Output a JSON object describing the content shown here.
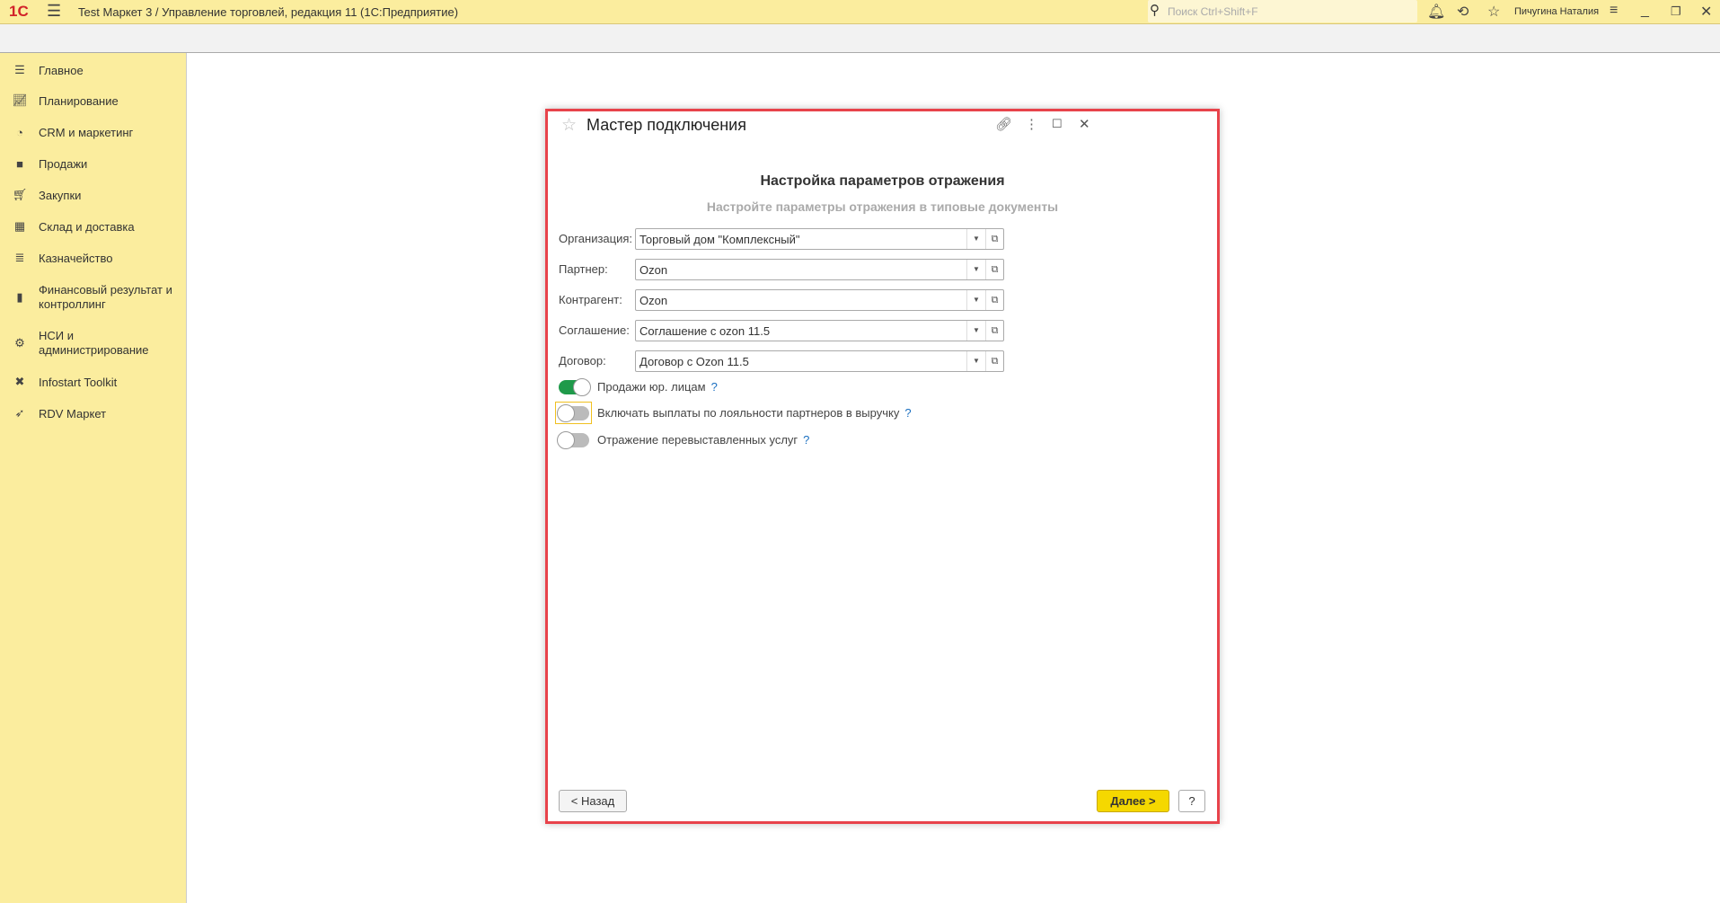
{
  "topbar": {
    "logo": "1С",
    "title": "Test Маркет 3 / Управление торговлей, редакция 11  (1С:Предприятие)",
    "search_placeholder": "Поиск Ctrl+Shift+F",
    "user": "Пичугина Наталия"
  },
  "sidebar": {
    "items": [
      {
        "label": "Главное",
        "icon": "menu-icon"
      },
      {
        "label": "Планирование",
        "icon": "chart-icon"
      },
      {
        "label": "CRM и маркетинг",
        "icon": "pie-icon"
      },
      {
        "label": "Продажи",
        "icon": "bag-icon"
      },
      {
        "label": "Закупки",
        "icon": "cart-icon"
      },
      {
        "label": "Склад и доставка",
        "icon": "grid-icon"
      },
      {
        "label": "Казначейство",
        "icon": "coins-icon"
      },
      {
        "label": "Финансовый результат и контроллинг",
        "icon": "bar-chart-icon"
      },
      {
        "label": "НСИ и администрирование",
        "icon": "gear-icon"
      },
      {
        "label": "Infostart Toolkit",
        "icon": "tools-icon"
      },
      {
        "label": "RDV Маркет",
        "icon": "rocket-icon"
      }
    ]
  },
  "dialog": {
    "title": "Мастер подключения",
    "heading": "Настройка параметров отражения",
    "subheading": "Настройте параметры отражения в типовые документы",
    "fields": [
      {
        "label": "Организация:",
        "value": "Торговый дом \"Комплексный\""
      },
      {
        "label": "Партнер:",
        "value": "Ozon"
      },
      {
        "label": "Контрагент:",
        "value": "Ozon"
      },
      {
        "label": "Соглашение:",
        "value": "Соглашение с ozon 11.5"
      },
      {
        "label": "Договор:",
        "value": "Договор с Ozon 11.5"
      }
    ],
    "toggles": [
      {
        "label": "Продажи юр. лицам",
        "on": true
      },
      {
        "label": "Включать выплаты по лояльности партнеров в выручку",
        "on": false
      },
      {
        "label": "Отражение перевыставленных услуг",
        "on": false
      }
    ],
    "help_mark": "?",
    "back_label": "< Назад",
    "next_label": "Далее >",
    "help_label": "?"
  },
  "colors": {
    "accent": "#fbed9e",
    "highlight": "#e8434b",
    "next": "#f5d800",
    "toggle_on": "#1f9a4a"
  }
}
